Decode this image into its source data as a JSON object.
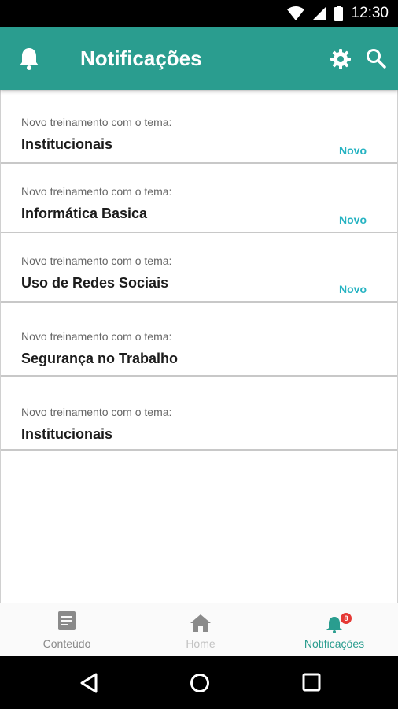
{
  "status_bar": {
    "time": "12:30"
  },
  "app_bar": {
    "title": "Notificações"
  },
  "notifications": [
    {
      "subtitle": "Novo treinamento com o tema:",
      "topic": "Institucionais",
      "badge": "Novo"
    },
    {
      "subtitle": "Novo treinamento com o tema:",
      "topic": "Informática Basica",
      "badge": "Novo"
    },
    {
      "subtitle": "Novo treinamento com o tema:",
      "topic": "Uso de Redes Sociais",
      "badge": "Novo"
    },
    {
      "subtitle": "Novo treinamento com o tema:",
      "topic": "Segurança no Trabalho"
    },
    {
      "subtitle": "Novo treinamento com o tema:",
      "topic": "Institucionais"
    }
  ],
  "bottom_nav": {
    "conteudo": "Conteúdo",
    "home": "Home",
    "notificacoes": "Notificações",
    "notif_count": "8"
  },
  "colors": {
    "primary": "#2a9d8f",
    "badge_text": "#26b3c2",
    "alert": "#e53935"
  },
  "icons": [
    "bell-icon",
    "gear-icon",
    "search-icon",
    "document-icon",
    "home-icon",
    "back-icon",
    "home-circle-icon",
    "recents-icon",
    "wifi-icon",
    "signal-icon",
    "battery-icon"
  ]
}
